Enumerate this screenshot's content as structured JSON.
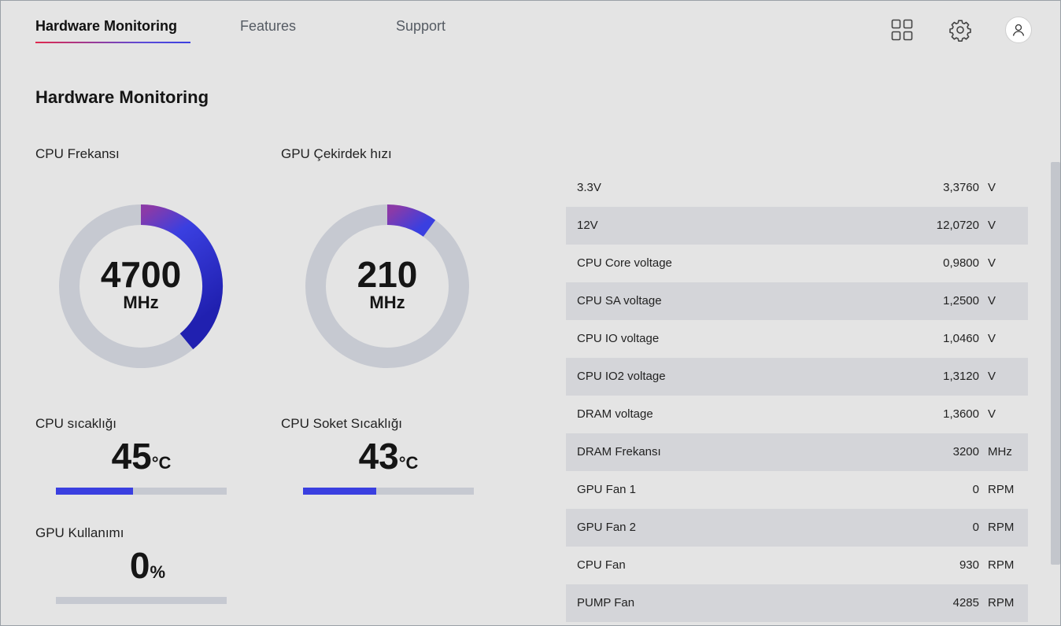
{
  "nav": {
    "tabs": [
      {
        "label": "Hardware Monitoring",
        "active": true
      },
      {
        "label": "Features",
        "active": false
      },
      {
        "label": "Support",
        "active": false
      }
    ],
    "icons": [
      "grid-icon",
      "gear-icon",
      "user-icon"
    ]
  },
  "page": {
    "title": "Hardware Monitoring"
  },
  "gauges": {
    "cpu_freq": {
      "label": "CPU Frekansı",
      "value": "4700",
      "unit": "MHz",
      "fill_fraction": 0.39
    },
    "gpu_core": {
      "label": "GPU Çekirdek hızı",
      "value": "210",
      "unit": "MHz",
      "fill_fraction": 0.1
    }
  },
  "metrics": {
    "cpu_temp": {
      "label": "CPU sıcaklığı",
      "value": "45",
      "unit": "°C",
      "fill_fraction": 0.45
    },
    "socket_temp": {
      "label": "CPU Soket Sıcaklığı",
      "value": "43",
      "unit": "°C",
      "fill_fraction": 0.43
    },
    "gpu_usage": {
      "label": "GPU Kullanımı",
      "value": "0",
      "unit": "%",
      "fill_fraction": 0.0
    }
  },
  "sensors": [
    {
      "name": "3.3V",
      "value": "3,3760",
      "unit": "V"
    },
    {
      "name": "12V",
      "value": "12,0720",
      "unit": "V"
    },
    {
      "name": "CPU Core voltage",
      "value": "0,9800",
      "unit": "V"
    },
    {
      "name": "CPU SA voltage",
      "value": "1,2500",
      "unit": "V"
    },
    {
      "name": "CPU IO voltage",
      "value": "1,0460",
      "unit": "V"
    },
    {
      "name": "CPU IO2 voltage",
      "value": "1,3120",
      "unit": "V"
    },
    {
      "name": "DRAM voltage",
      "value": "1,3600",
      "unit": "V"
    },
    {
      "name": "DRAM Frekansı",
      "value": "3200",
      "unit": "MHz"
    },
    {
      "name": "GPU Fan 1",
      "value": "0",
      "unit": "RPM"
    },
    {
      "name": "GPU Fan 2",
      "value": "0",
      "unit": "RPM"
    },
    {
      "name": "CPU Fan",
      "value": "930",
      "unit": "RPM"
    },
    {
      "name": "PUMP Fan",
      "value": "4285",
      "unit": "RPM"
    }
  ],
  "colors": {
    "accent": "#3a3fe0",
    "accent_dark": "#2a2ab8",
    "accent_start": "#8a3aa8",
    "track": "#c6c9d1"
  }
}
